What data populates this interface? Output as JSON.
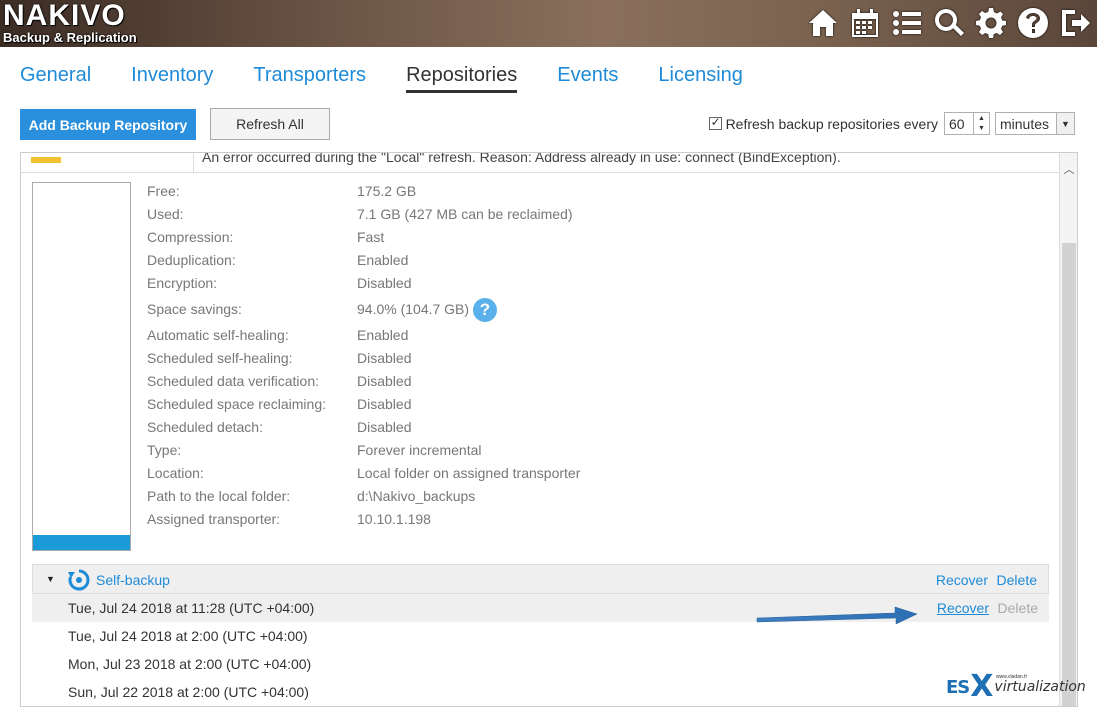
{
  "header": {
    "logo_main": "NAKIVO",
    "logo_sub": "Backup & Replication",
    "icons": [
      "home-icon",
      "calendar-icon",
      "list-icon",
      "search-icon",
      "gear-icon",
      "help-icon",
      "logout-icon"
    ]
  },
  "tabs": [
    {
      "label": "General",
      "active": false
    },
    {
      "label": "Inventory",
      "active": false
    },
    {
      "label": "Transporters",
      "active": false
    },
    {
      "label": "Repositories",
      "active": true
    },
    {
      "label": "Events",
      "active": false
    },
    {
      "label": "Licensing",
      "active": false
    }
  ],
  "toolbar": {
    "add_label": "Add Backup Repository",
    "refresh_label": "Refresh All",
    "auto_refresh_label": "Refresh backup repositories every",
    "auto_refresh_checked": true,
    "interval_value": "60",
    "interval_unit": "minutes"
  },
  "error_row": {
    "text": "An error occurred during the \"Local\" refresh. Reason: Address already in use: connect (BindException)."
  },
  "repository": {
    "usage_fraction": 0.04,
    "properties": [
      {
        "key": "Free:",
        "value": "175.2 GB"
      },
      {
        "key": "Used:",
        "value": "7.1 GB (427 MB can be reclaimed)"
      },
      {
        "key": "Compression:",
        "value": "Fast"
      },
      {
        "key": "Deduplication:",
        "value": "Enabled"
      },
      {
        "key": "Encryption:",
        "value": "Disabled"
      },
      {
        "key": "Space savings:",
        "value": "94.0% (104.7 GB)"
      },
      {
        "key": "Automatic self-healing:",
        "value": "Enabled"
      },
      {
        "key": "Scheduled self-healing:",
        "value": "Disabled"
      },
      {
        "key": "Scheduled data verification:",
        "value": "Disabled"
      },
      {
        "key": "Scheduled space reclaiming:",
        "value": "Disabled"
      },
      {
        "key": "Scheduled detach:",
        "value": "Disabled"
      },
      {
        "key": "Type:",
        "value": "Forever incremental"
      },
      {
        "key": "Location:",
        "value": "Local folder on assigned transporter"
      },
      {
        "key": "Path to the local folder:",
        "value": "d:\\Nakivo_backups"
      },
      {
        "key": "Assigned transporter:",
        "value": "10.10.1.198"
      }
    ],
    "help_glyph": "?"
  },
  "backups": {
    "name": "Self-backup",
    "recover_label": "Recover",
    "delete_label": "Delete",
    "items": [
      {
        "time": "Tue, Jul 24 2018 at 11:28 (UTC +04:00)",
        "recover": "Recover",
        "delete": "Delete"
      },
      {
        "time": "Tue, Jul 24 2018 at 2:00 (UTC +04:00)"
      },
      {
        "time": "Mon, Jul 23 2018 at 2:00 (UTC +04:00)"
      },
      {
        "time": "Sun, Jul 22 2018 at 2:00 (UTC +04:00)"
      }
    ]
  },
  "watermark": {
    "es": "ES",
    "x": "X",
    "virt": "virtualization",
    "url": "www.vladan.fr"
  }
}
